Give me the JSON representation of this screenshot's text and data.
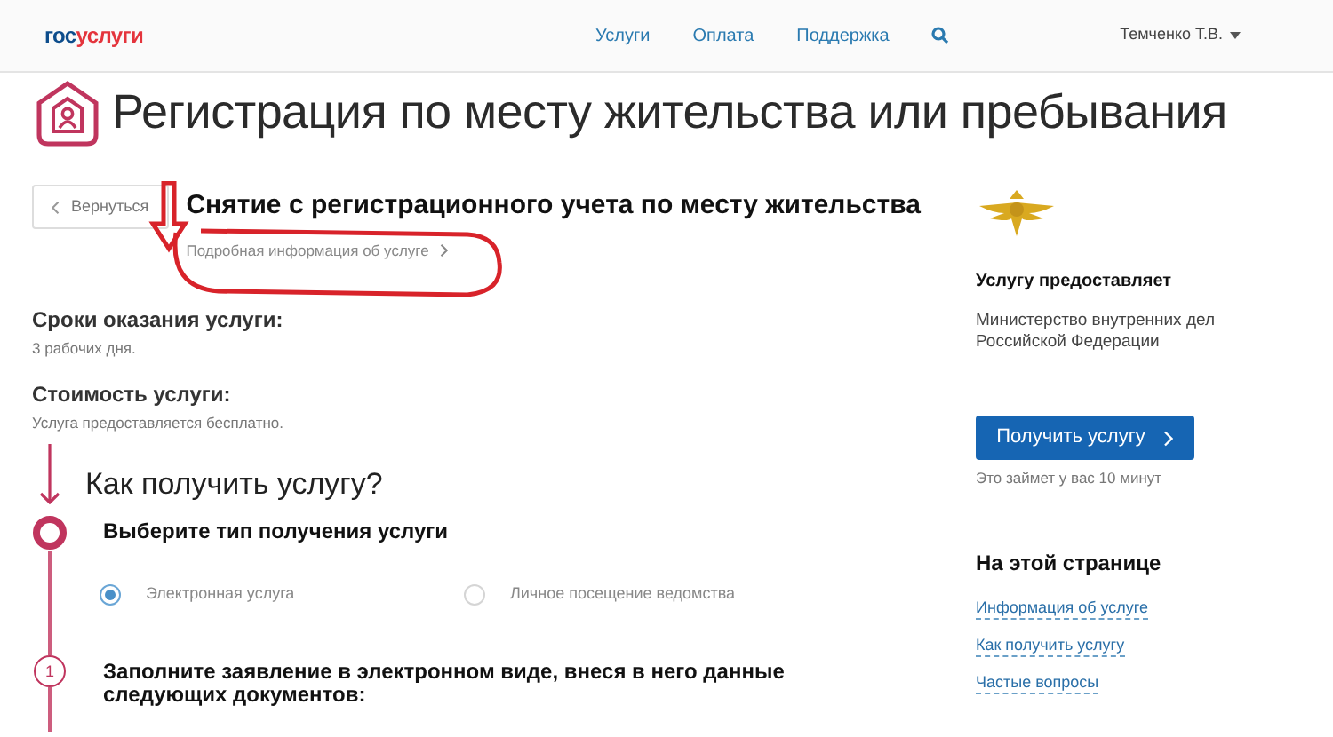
{
  "header": {
    "logo": {
      "part_1": "гос",
      "part_2": "услуги"
    },
    "nav": [
      {
        "label": "Услуги"
      },
      {
        "label": "Оплата"
      },
      {
        "label": "Поддержка"
      }
    ],
    "user": "Темченко Т.В."
  },
  "page_title": "Регистрация по месту жительства или пребывания",
  "back_button": "Вернуться",
  "service": {
    "title": "Снятие с регистрационного учета по месту жительства",
    "details_link": "Подробная информация об услуге"
  },
  "info": [
    {
      "label": "Сроки оказания услуги:",
      "value": "3 рабочих дня."
    },
    {
      "label": "Стоимость услуги:",
      "value": "Услуга предоставляется бесплатно."
    }
  ],
  "how_to": {
    "title": "Как получить услугу?",
    "steps": [
      {
        "kind": "choice",
        "title": "Выберите тип получения услуги",
        "options": [
          {
            "label": "Электронная услуга",
            "selected": true
          },
          {
            "label": "Личное посещение ведомства",
            "selected": false
          }
        ]
      },
      {
        "kind": "numbered",
        "number": "1",
        "title": "Заполните заявление в электронном виде, внеся в него данные следующих документов:"
      }
    ]
  },
  "sidebar": {
    "provider_label": "Услугу предоставляет",
    "provider": "Министерство внутренних дел Российской Федерации",
    "button": "Получить услугу",
    "button_note": "Это займет у вас 10 минут",
    "on_page_title": "На этой странице",
    "links": [
      "Информация об услуге",
      "Как получить услугу",
      "Частые вопросы"
    ]
  }
}
